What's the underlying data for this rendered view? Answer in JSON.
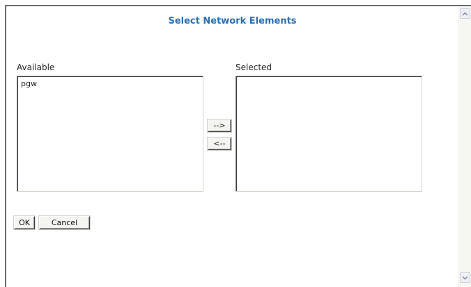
{
  "dialog": {
    "title": "Select Network Elements"
  },
  "available": {
    "label": "Available",
    "items": [
      "pgw"
    ]
  },
  "selected": {
    "label": "Selected",
    "items": []
  },
  "move_buttons": {
    "add_label": "-->",
    "remove_label": "<--"
  },
  "actions": {
    "ok_label": "OK",
    "cancel_label": "Cancel"
  },
  "colors": {
    "title": "#2a6fb0",
    "frame_border": "#6b6b6b"
  },
  "icons": {
    "scroll_up": "chevron-up-icon",
    "scroll_down": "chevron-down-icon"
  }
}
